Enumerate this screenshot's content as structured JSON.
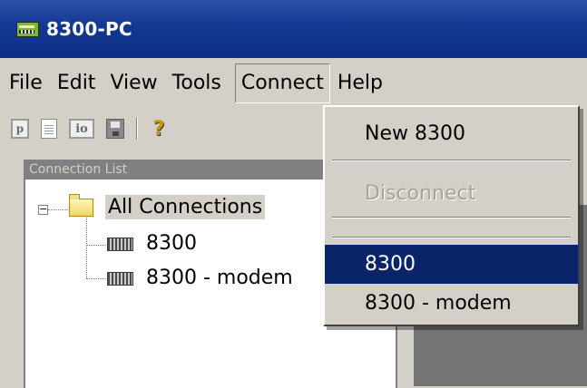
{
  "window": {
    "title": "8300-PC"
  },
  "menubar": {
    "items": [
      {
        "label": "File"
      },
      {
        "label": "Edit"
      },
      {
        "label": "View"
      },
      {
        "label": "Tools"
      },
      {
        "label": "Connect"
      },
      {
        "label": "Help"
      }
    ]
  },
  "toolbar": {
    "buttons": [
      {
        "text": "p",
        "icon": "p-icon"
      },
      {
        "text": "",
        "icon": "document-icon"
      },
      {
        "text": "io",
        "icon": "io-icon"
      },
      {
        "text": "",
        "icon": "save-icon"
      },
      {
        "text": "?",
        "icon": "help-icon"
      }
    ]
  },
  "connection_list": {
    "header": "Connection List",
    "root": "All Connections",
    "children": [
      "8300",
      "8300 - modem"
    ]
  },
  "connect_menu": {
    "items": [
      {
        "label": "New 8300",
        "enabled": true
      },
      {
        "label": "Disconnect",
        "enabled": false
      },
      {
        "label": "8300",
        "enabled": true,
        "highlighted": true
      },
      {
        "label": "8300 - modem",
        "enabled": true
      }
    ]
  },
  "colors": {
    "titlebar": "#153a94",
    "selection": "#0a246a",
    "face": "#d4d0c8",
    "disabled_text": "#a6a39b"
  }
}
